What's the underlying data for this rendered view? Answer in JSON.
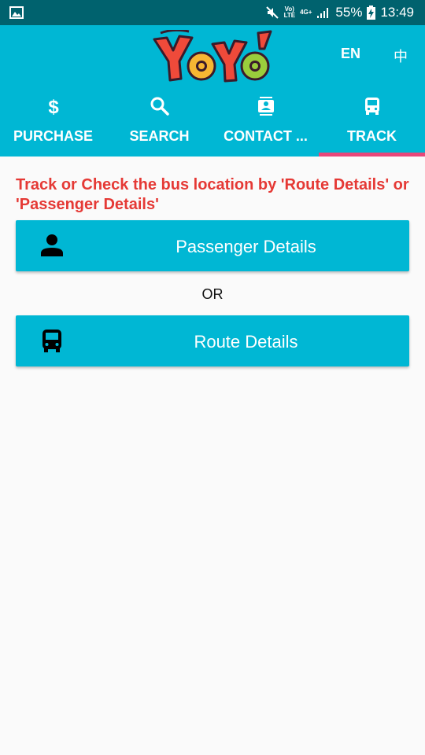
{
  "status_bar": {
    "volte": "Vo)",
    "lte": "LTE",
    "network": "4G+",
    "battery": "55%",
    "time": "13:49"
  },
  "header": {
    "logo_text": "YOYO",
    "languages": [
      "EN",
      "中"
    ]
  },
  "tabs": [
    {
      "label": "PURCHASE",
      "icon": "dollar-icon"
    },
    {
      "label": "SEARCH",
      "icon": "search-icon"
    },
    {
      "label": "CONTACT ...",
      "icon": "contact-card-icon"
    },
    {
      "label": "TRACK",
      "icon": "bus-icon",
      "active": true
    }
  ],
  "main": {
    "heading": "Track or Check the bus location by 'Route Details' or 'Passenger Details'",
    "passenger_button": "Passenger Details",
    "or_text": "OR",
    "route_button": "Route Details"
  },
  "colors": {
    "status_bar": "#00626e",
    "primary": "#00b7d4",
    "tab_indicator": "#e8477a",
    "heading_text": "#e53935",
    "background": "#fafafa"
  }
}
